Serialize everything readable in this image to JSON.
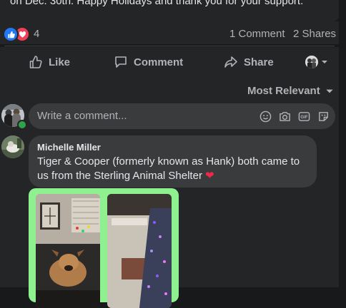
{
  "post": {
    "text_fragment": "on Dec. 30th. Happy Holidays and thank you for your support."
  },
  "stats": {
    "reaction_count": "4",
    "comments": "1 Comment",
    "shares": "2 Shares"
  },
  "actions": {
    "like": "Like",
    "comment": "Comment",
    "share": "Share"
  },
  "sort": {
    "label": "Most Relevant"
  },
  "composer": {
    "placeholder": "Write a comment..."
  },
  "comments": [
    {
      "author": "Michelle Miller",
      "text": "Tiger & Cooper (formerly known as Hank) both came to us from the Sterling Animal Shelter",
      "emoji": "❤"
    }
  ],
  "colors": {
    "background": "#18191a",
    "card": "#242526",
    "bubble": "#3a3b3c",
    "like_blue": "#2078f4",
    "love_red": "#f33e58",
    "online_green": "#31a24c",
    "photo_frame": "#8ff08f"
  },
  "icons": [
    "like-reaction-icon",
    "love-reaction-icon",
    "thumbs-up-icon",
    "speech-bubble-icon",
    "share-arrow-icon",
    "chevron-down-icon",
    "smiley-icon",
    "camera-icon",
    "gif-icon",
    "sticker-icon"
  ]
}
